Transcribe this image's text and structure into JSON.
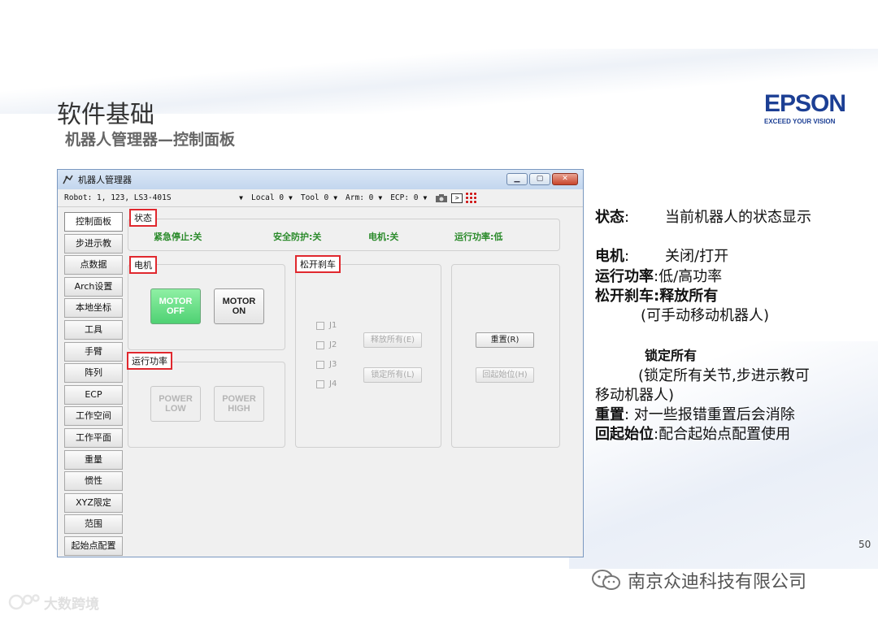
{
  "slide": {
    "title": "软件基础",
    "subtitle": "机器人管理器—控制面板",
    "page_number": "50"
  },
  "logo": {
    "brand": "EPSON",
    "tagline": "EXCEED YOUR VISION",
    "color": "#1c3f94"
  },
  "window": {
    "title": "机器人管理器",
    "controls": [
      "minimize-icon",
      "maximize-icon",
      "close-icon"
    ]
  },
  "toolbar": {
    "robot": "Robot: 1, 123, LS3-401S",
    "local": "Local 0",
    "tool": "Tool 0",
    "arm": "Arm: 0",
    "ecp": "ECP: 0"
  },
  "sidebar": {
    "items": [
      "控制面板",
      "步进示教",
      "点数据",
      "Arch设置",
      "本地坐标",
      "工具",
      "手臂",
      "阵列",
      "ECP",
      "工作空间",
      "工作平面",
      "重量",
      "惯性",
      "XYZ限定",
      "范围",
      "起始点配置"
    ]
  },
  "status_group": {
    "label": "状态",
    "items": [
      "紧急停止:关",
      "安全防护:关",
      "电机:关",
      "运行功率:低"
    ],
    "color": "#2a8a2a"
  },
  "motor_group": {
    "label": "电机",
    "off_button": "MOTOR OFF",
    "on_button": "MOTOR ON"
  },
  "power_group": {
    "label": "运行功率",
    "low_button": "POWER LOW",
    "high_button": "POWER HIGH"
  },
  "brake_group": {
    "label": "松开刹车",
    "joints": [
      "J1",
      "J2",
      "J3",
      "J4"
    ],
    "release_all": "释放所有(E)",
    "lock_all": "锁定所有(L)"
  },
  "reset_group": {
    "reset_button": "重置(R)",
    "home_button": "回起始位(H)"
  },
  "description": {
    "status_key": "状态",
    "status_colon": ":",
    "status_text": "当前机器人的状态显示",
    "motor_key": "电机",
    "motor_colon": ":",
    "motor_text": "关闭/打开",
    "power_key": "运行功率",
    "power_text": ":低/高功率",
    "brake_key": "松开刹车",
    "brake_text": ":释放所有",
    "brake_note": "(可手动移动机器人)",
    "lock_title": "锁定所有",
    "lock_note_1": "(锁定所有关节,步进示教可",
    "lock_note_2": "移动机器人)",
    "reset_key": "重置",
    "reset_text": ":  对一些报错重置后会消除",
    "home_key": "回起始位",
    "home_text": ":配合起始点配置使用"
  },
  "footer": {
    "wechat_name": "南京众迪科技有限公司",
    "watermark": "大数跨境"
  }
}
